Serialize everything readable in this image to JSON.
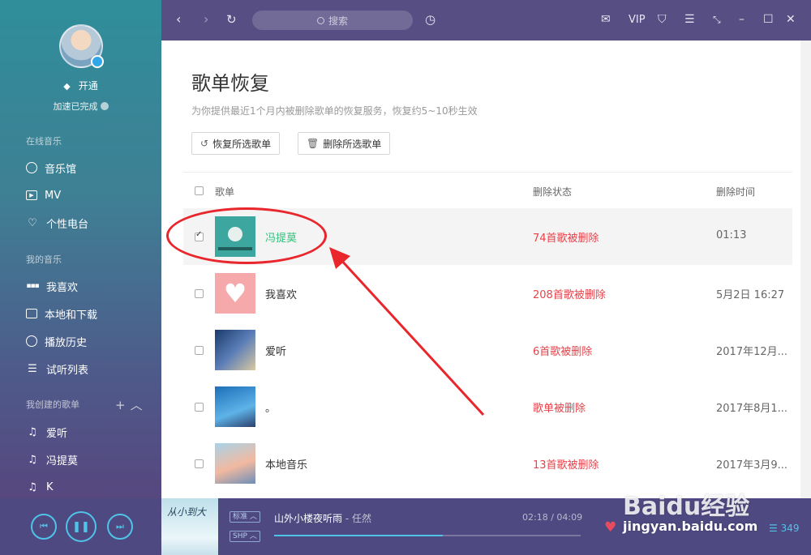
{
  "sidebar": {
    "vip_label": "开通",
    "accel_status": "加速已完成",
    "sections": {
      "online": "在线音乐",
      "my_music": "我的音乐",
      "created": "我创建的歌单"
    },
    "online_items": [
      {
        "label": "音乐馆",
        "icon": "music-hall-icon"
      },
      {
        "label": "MV",
        "icon": "mv-icon"
      },
      {
        "label": "个性电台",
        "icon": "radio-heart-icon"
      }
    ],
    "my_items": [
      {
        "label": "我喜欢",
        "icon": "like-bars-icon"
      },
      {
        "label": "本地和下载",
        "icon": "monitor-icon"
      },
      {
        "label": "播放历史",
        "icon": "clock-icon"
      },
      {
        "label": "试听列表",
        "icon": "playlist-icon"
      }
    ],
    "created_items": [
      {
        "label": "爱听",
        "icon": "note-icon"
      },
      {
        "label": "冯提莫",
        "icon": "note-icon"
      },
      {
        "label": "K",
        "icon": "note-icon"
      }
    ]
  },
  "topbar": {
    "search_placeholder": "搜索",
    "vip": "VIP"
  },
  "page": {
    "title": "歌单恢复",
    "description": "为你提供最近1个月内被删除歌单的恢复服务，恢复约5~10秒生效",
    "restore_button": "恢复所选歌单",
    "delete_button": "删除所选歌单"
  },
  "table": {
    "headers": {
      "name": "歌单",
      "status": "删除状态",
      "time": "删除时间"
    },
    "rows": [
      {
        "name": "冯提莫",
        "status": "74首歌被删除",
        "time": "01:13",
        "checked": true
      },
      {
        "name": "我喜欢",
        "status": "208首歌被删除",
        "time": "5月2日 16:27",
        "checked": false
      },
      {
        "name": "爱听",
        "status": "6首歌被删除",
        "time": "2017年12月...",
        "checked": false
      },
      {
        "name": "。",
        "status": "歌单被删除",
        "time": "2017年8月1...",
        "checked": false
      },
      {
        "name": "本地音乐",
        "status": "13首歌被删除",
        "time": "2017年3月9...",
        "checked": false
      }
    ]
  },
  "player": {
    "album_text": "从小到大",
    "quality": "标准",
    "format": "SHP",
    "song": "山外小楼夜听雨",
    "separator": " - ",
    "artist": "任然",
    "time": "02:18 / 04:09",
    "progress": 0.55,
    "playlist_count": "349"
  },
  "watermark": {
    "brand": "Baidu经验",
    "url": "jingyan.baidu.com"
  },
  "colors": {
    "accent_green": "#31c27c",
    "delete_red": "#e6424a",
    "annotation_red": "#e8262c",
    "player_blue": "#4fc3e8"
  }
}
